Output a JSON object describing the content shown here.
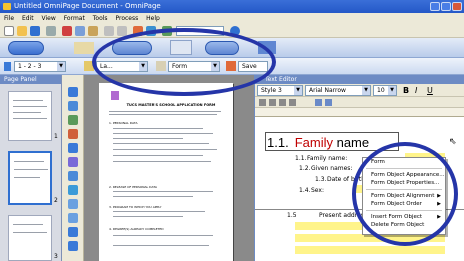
{
  "window": {
    "title": "Untitled OmniPage Document - OmniPage"
  },
  "menu": [
    "File",
    "Edit",
    "View",
    "Format",
    "Tools",
    "Process",
    "Help"
  ],
  "toolbar3": {
    "page_range": "1 - 2 - 3",
    "layout": "La...",
    "form": "Form",
    "save": "Save"
  },
  "page_panel": {
    "title": "Page Panel",
    "thumbs": [
      "1",
      "2",
      "3"
    ]
  },
  "page_image": {
    "title": "TUCS MASTER'S SCHOOL APPLICATION FORM",
    "sections": [
      "1. PERSONAL DATA",
      "2. RELEASE OF PERSONAL DATA",
      "3. PROGRAM TO WHICH YOU APPLY",
      "4. DEGREE(S) ALREADY COMPLETED"
    ]
  },
  "text_editor": {
    "title": "Text Editor",
    "style": "Style 3",
    "font": "Arial Narrow",
    "size": "10",
    "heading_num": "1.1.",
    "heading_text": "Family",
    "heading_tail": "name",
    "fields": [
      {
        "num": "1.1.",
        "label": "Family name:"
      },
      {
        "num": "1.2.",
        "label": "Given names:"
      },
      {
        "num": "1.3.",
        "label": "Date of birth (dd.mm.yyyy):"
      },
      {
        "num": "1.4.",
        "label": "Sex:"
      }
    ],
    "row_num": "1.5",
    "row_label": "Present address,"
  },
  "context_menu": {
    "items": [
      {
        "label": "Form",
        "sub": false
      },
      {
        "label": "Form Object Appearance...",
        "sub": false
      },
      {
        "label": "Form Object Properties...",
        "sub": false
      },
      {
        "label": "Form Object Alignment",
        "sub": true
      },
      {
        "label": "Form Object Order",
        "sub": true
      },
      {
        "label": "Insert Form Object",
        "sub": true
      },
      {
        "label": "Delete Form Object",
        "sub": false
      }
    ]
  },
  "colors": {
    "highlight_ring": "#2535a8",
    "heading_red": "#c00000",
    "field_yellow": "#fff48a"
  }
}
